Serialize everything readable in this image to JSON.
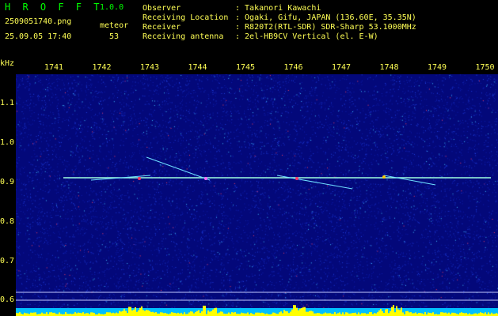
{
  "app": {
    "title": "H R O F F T",
    "version": "1.0.0"
  },
  "file": {
    "name": "2509051740.png",
    "datetime": "25.09.05 17:40"
  },
  "stat": {
    "label": "meteor",
    "count": "53"
  },
  "info": [
    {
      "key": "Observer",
      "value": ": Takanori Kawachi"
    },
    {
      "key": "Receiving Location",
      "value": ": Ogaki, Gifu, JAPAN (136.60E, 35.35N)"
    },
    {
      "key": "Receiver",
      "value": ": R820T2(RTL-SDR) SDR-Sharp 53.1000MHz"
    },
    {
      "key": "Receiving antenna",
      "value": ": 2el-HB9CV Vertical (el. E-W)"
    }
  ],
  "axis": {
    "unit": "kHz",
    "x_ticks": [
      "1741",
      "1742",
      "1743",
      "1744",
      "1745",
      "1746",
      "1747",
      "1748",
      "1749",
      "1750"
    ],
    "y_ticks": [
      "1.1",
      "1.0",
      "0.9",
      "0.8",
      "0.7",
      "0.6"
    ]
  },
  "colors": {
    "background": "#000000",
    "spectrogram": "#03087a",
    "carrier": "#7fffd4",
    "header_green": "#00ff00",
    "header_yellow": "#ffff55",
    "power_bar": "#ffff00",
    "power_base": "#00bfff"
  }
}
